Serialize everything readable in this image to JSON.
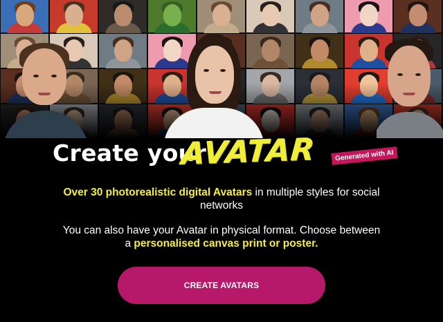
{
  "hero": {
    "tile_palette": [
      [
        "#3a6fb8",
        "#d9a77c",
        "#6b3f1e",
        "#c43b3b"
      ],
      [
        "#c9342f",
        "#e0b08a",
        "#2d1d12",
        "#1f4fa0"
      ],
      [
        "#4d7b2b",
        "#77b04c",
        "#3b5d20",
        "#2b6d2a"
      ],
      [
        "#2c3036",
        "#b58464",
        "#1a1a1a",
        "#b99a3a"
      ],
      [
        "#6f7c86",
        "#cfa486",
        "#4a2d1e",
        "#8e949a"
      ],
      [
        "#d0342c",
        "#efe3d8",
        "#111111",
        "#c41e3a"
      ],
      [
        "#7a6650",
        "#b28768",
        "#3a2a1d",
        "#6d5138"
      ],
      [
        "#c53a2b",
        "#d9b08f",
        "#4a3020",
        "#e3c23b"
      ],
      [
        "#262626",
        "#c99676",
        "#2b1b12",
        "#ad3a3a"
      ],
      [
        "#a08e78",
        "#d8b195",
        "#6a4a33",
        "#c3ab8c"
      ],
      [
        "#e23e2f",
        "#f1c39a",
        "#191919",
        "#1e6fd0"
      ],
      [
        "#ee9bb0",
        "#f1d6c6",
        "#1b1413",
        "#2b3a8c"
      ],
      [
        "#8a8f95",
        "#c89c82",
        "#262626",
        "#4b4b4b"
      ],
      [
        "#403018",
        "#c28a66",
        "#1c140e",
        "#b18a2c"
      ],
      [
        "#2f2b28",
        "#b98c6e",
        "#181818",
        "#6a5a4a"
      ],
      [
        "#a3a7ab",
        "#d9b8a3",
        "#3a2a20",
        "#6e6e6e"
      ],
      [
        "#d8c9b8",
        "#e7c8b0",
        "#2a1f1a",
        "#333333"
      ],
      [
        "#4a5b6a",
        "#c19478",
        "#2b221d",
        "#7a2a2a"
      ],
      [
        "#5a2f1f",
        "#c48c70",
        "#221510",
        "#20325c"
      ]
    ],
    "portrait_colors": {
      "boy": {
        "bg": "#3b3530",
        "skin": "#d9a98a",
        "hair": "#4a321f",
        "shirt": "#2f3e4c"
      },
      "woman": {
        "bg": "#2b2624",
        "skin": "#e8c3a8",
        "hair": "#2a1a12",
        "shirt": "#f2f2f2"
      },
      "man": {
        "bg": "#2e2a26",
        "skin": "#d6a58a",
        "hair": "#241812",
        "shirt": "#7a7f86"
      }
    }
  },
  "headline": {
    "lead": "Create your",
    "highlight": "AVATAR",
    "badge": "Generated with AI",
    "highlight_color": "#f1ee3a",
    "badge_color": "#c2185b"
  },
  "copy": {
    "p1_highlight": "Over 30 photorealistic digital Avatars",
    "p1_rest": " in multiple styles for social networks",
    "p2_start": "You can also have your Avatar in physical format. Choose between a ",
    "p2_highlight": "personalised canvas print or poster.",
    "highlight_color": "#f7ef3f"
  },
  "cta": {
    "label": "CREATE AVATARS",
    "color": "#b6196a"
  }
}
